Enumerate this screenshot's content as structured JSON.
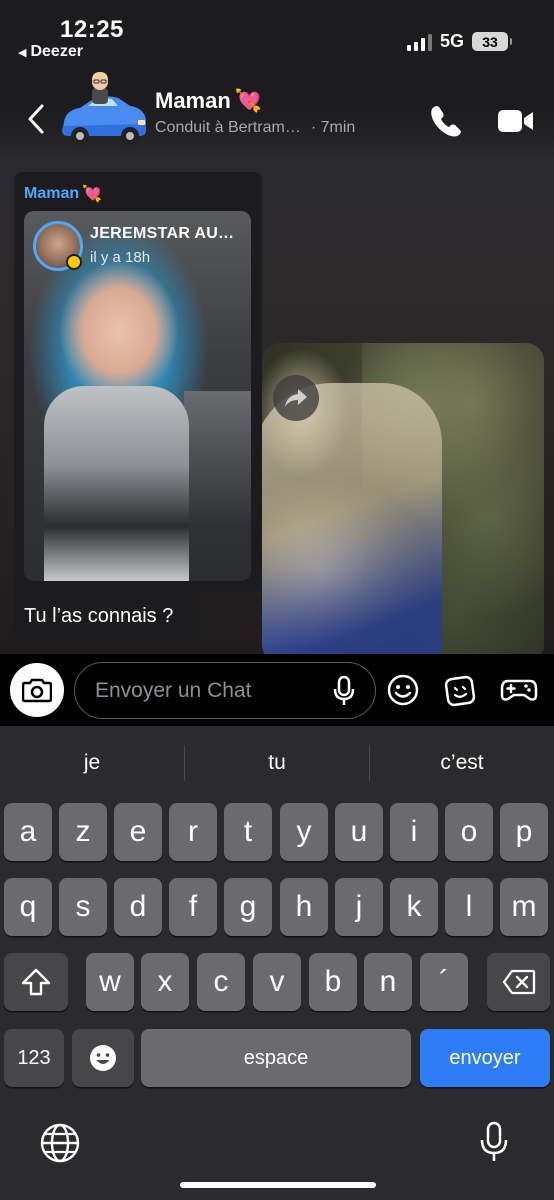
{
  "status_bar": {
    "time": "12:25",
    "back_app": "Deezer",
    "network": "5G",
    "battery": "33"
  },
  "header": {
    "contact_name": "Maman",
    "name_emoji": "💘",
    "location": "Conduit à Bertram…",
    "time_ago": "· 7min"
  },
  "message": {
    "sender": "Maman",
    "sender_emoji": "💘",
    "story": {
      "title": "JEREMSTAR AU…",
      "time": "il y a 18h"
    },
    "text": "Tu l’as connais ?"
  },
  "composer": {
    "placeholder": "Envoyer un Chat"
  },
  "keyboard": {
    "suggestions": [
      "je",
      "tu",
      "c’est"
    ],
    "row1": [
      "a",
      "z",
      "e",
      "r",
      "t",
      "y",
      "u",
      "i",
      "o",
      "p"
    ],
    "row2": [
      "q",
      "s",
      "d",
      "f",
      "g",
      "h",
      "j",
      "k",
      "l",
      "m"
    ],
    "row3": [
      "w",
      "x",
      "c",
      "v",
      "b",
      "n",
      "´"
    ],
    "numbers_label": "123",
    "space_label": "espace",
    "send_label": "envoyer"
  },
  "colors": {
    "accent_blue": "#4da8ff",
    "send_key": "#2e7cf6",
    "key": "#6b6b6f",
    "key_dark": "#474749"
  }
}
